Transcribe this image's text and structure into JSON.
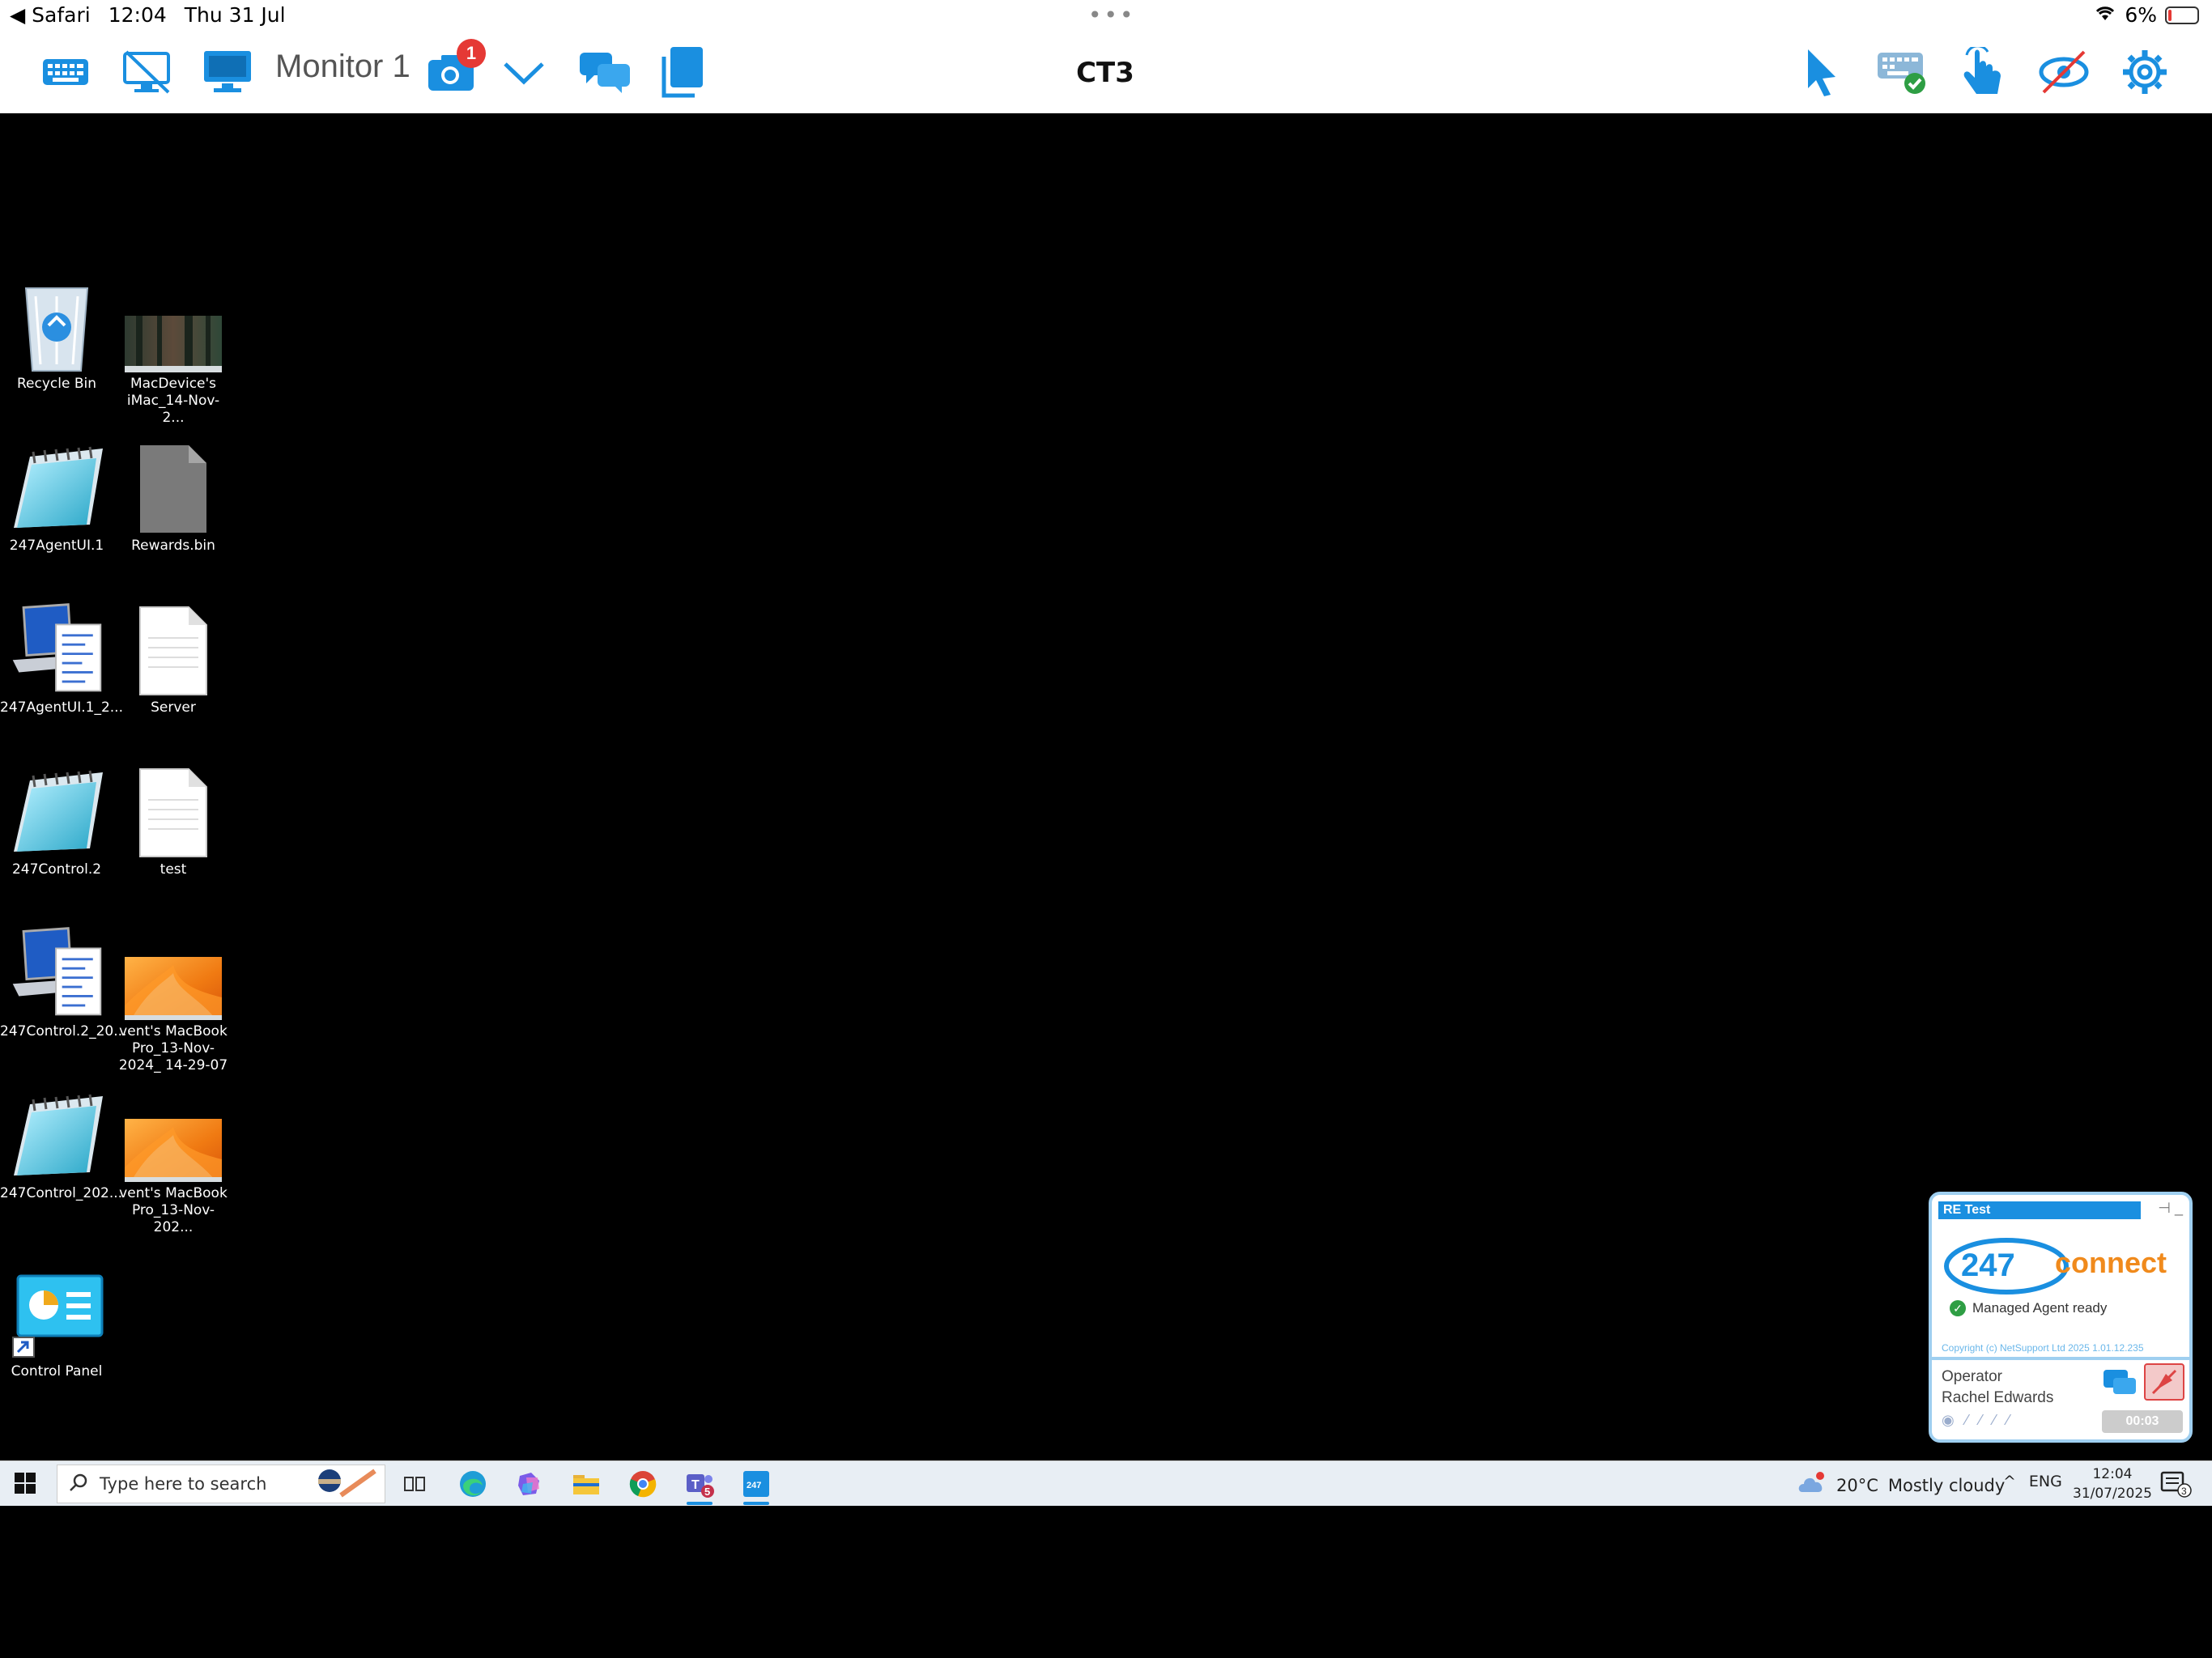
{
  "status_bar": {
    "back_app": "◀ Safari",
    "time": "12:04",
    "date": "Thu 31 Jul",
    "dots": "•••",
    "battery": "6%"
  },
  "toolbar": {
    "monitor_label": "Monitor 1",
    "camera_badge": "1",
    "title": "CT3"
  },
  "desktop": {
    "icons": [
      {
        "label": "Recycle Bin"
      },
      {
        "label": "MacDevice's iMac_14-Nov-2..."
      },
      {
        "label": "247AgentUI.1"
      },
      {
        "label": "Rewards.bin"
      },
      {
        "label": "247AgentUI.1_2..."
      },
      {
        "label": "Server"
      },
      {
        "label": "247Control.2"
      },
      {
        "label": "test"
      },
      {
        "label": "247Control.2_20..."
      },
      {
        "label": "vent's MacBook Pro_13-Nov-2024_ 14-29-07"
      },
      {
        "label": "247Control_202..."
      },
      {
        "label": "vent's MacBook Pro_13-Nov-202..."
      },
      {
        "label": "Control Panel"
      }
    ]
  },
  "widget": {
    "title": "RE Test",
    "logo_num": "247",
    "logo_word": "connect",
    "status": "Managed Agent ready",
    "copyright": "Copyright (c) NetSupport Ltd 2025   1.01.12.235",
    "operator_label": "Operator",
    "operator_name": "Rachel Edwards",
    "timer": "00:03"
  },
  "taskbar": {
    "search_placeholder": "Type here to search",
    "teams_badge": "5",
    "temperature": "20°C",
    "weather": "Mostly cloudy",
    "chevron": "^",
    "language": "ENG",
    "time": "12:04",
    "date": "31/07/2025",
    "notif_count": "3"
  },
  "colors": {
    "accent": "#1a8fe0",
    "brand_orange": "#f08a1c",
    "badge_red": "#e53935"
  }
}
